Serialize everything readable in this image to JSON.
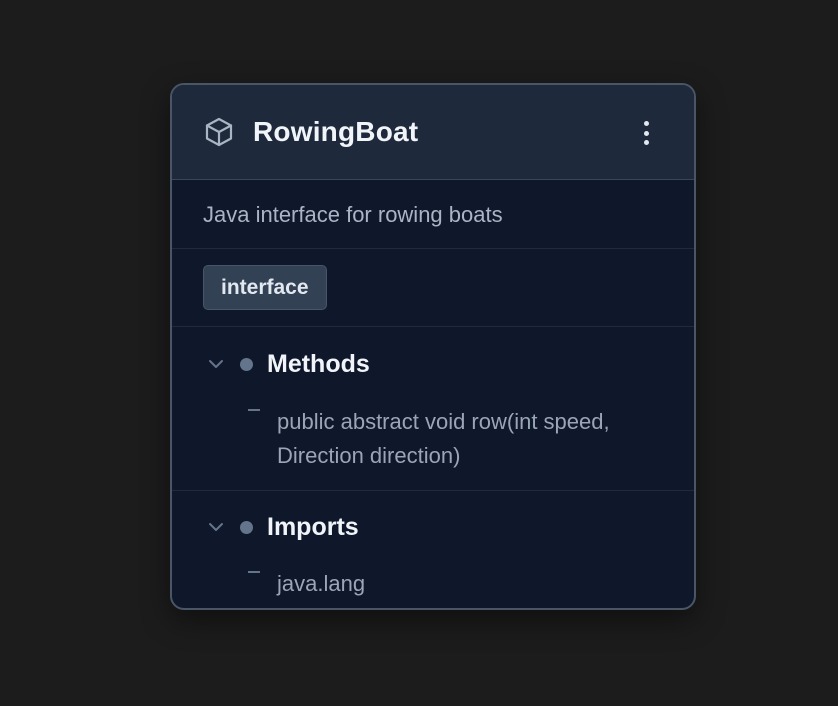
{
  "card": {
    "title": "RowingBoat",
    "icon": "cube-icon",
    "description": "Java interface for rowing boats",
    "tag": "interface"
  },
  "sections": [
    {
      "title": "Methods",
      "items": [
        "public abstract void row(int speed, Direction direction)"
      ]
    },
    {
      "title": "Imports",
      "items": [
        "java.lang"
      ]
    }
  ],
  "colors": {
    "background": "#1c1c1c",
    "card": "#0f172a",
    "header": "#1e293b",
    "tag": "#334155"
  }
}
